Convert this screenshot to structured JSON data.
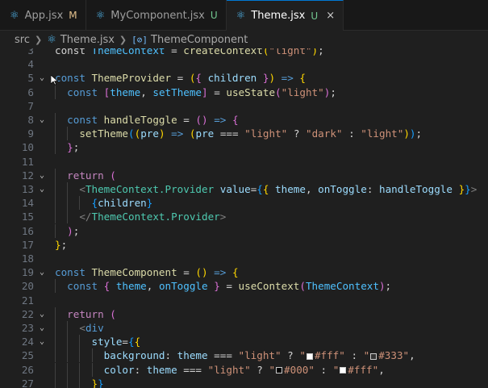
{
  "tabs": [
    {
      "label": "App.jsx",
      "status": "M",
      "active": false
    },
    {
      "label": "MyComponent.jsx",
      "status": "U",
      "active": false
    },
    {
      "label": "Theme.jsx",
      "status": "U",
      "active": true,
      "close": "×"
    }
  ],
  "breadcrumb": {
    "folder": "src",
    "file": "Theme.jsx",
    "symbol": "ThemeComponent"
  },
  "swatch_colors": {
    "fff": "#ffffff",
    "333": "#333333",
    "000": "#000000"
  },
  "lines": [
    {
      "n": "3",
      "fold": false,
      "code": [
        [
          "p",
          "const "
        ],
        [
          "c",
          "ThemeContext"
        ],
        [
          "p",
          " = "
        ],
        [
          "f",
          "createContext"
        ],
        [
          "b1",
          "("
        ],
        [
          "s",
          "\"light\""
        ],
        [
          "b1",
          ")"
        ],
        [
          "p",
          ";"
        ]
      ]
    },
    {
      "n": "4",
      "fold": false,
      "code": []
    },
    {
      "n": "5",
      "fold": true,
      "code": [
        [
          "k",
          "const "
        ],
        [
          "f",
          "ThemeProvider"
        ],
        [
          "p",
          " = "
        ],
        [
          "b1",
          "("
        ],
        [
          "b2",
          "{ "
        ],
        [
          "v",
          "children"
        ],
        [
          "b2",
          " }"
        ],
        [
          "b1",
          ")"
        ],
        [
          "p",
          " "
        ],
        [
          "k",
          "=>"
        ],
        [
          "p",
          " "
        ],
        [
          "b1",
          "{"
        ]
      ]
    },
    {
      "n": "6",
      "fold": false,
      "code": [
        [
          "p",
          "  "
        ],
        [
          "k",
          "const "
        ],
        [
          "b2",
          "["
        ],
        [
          "c",
          "theme"
        ],
        [
          "p",
          ", "
        ],
        [
          "c",
          "setTheme"
        ],
        [
          "b2",
          "]"
        ],
        [
          "p",
          " = "
        ],
        [
          "f",
          "useState"
        ],
        [
          "b2",
          "("
        ],
        [
          "s",
          "\"light\""
        ],
        [
          "b2",
          ")"
        ],
        [
          "p",
          ";"
        ]
      ]
    },
    {
      "n": "7",
      "fold": false,
      "code": []
    },
    {
      "n": "8",
      "fold": true,
      "code": [
        [
          "p",
          "  "
        ],
        [
          "k",
          "const "
        ],
        [
          "f",
          "handleToggle"
        ],
        [
          "p",
          " = "
        ],
        [
          "b2",
          "()"
        ],
        [
          "p",
          " "
        ],
        [
          "k",
          "=>"
        ],
        [
          "p",
          " "
        ],
        [
          "b2",
          "{"
        ]
      ]
    },
    {
      "n": "9",
      "fold": false,
      "code": [
        [
          "p",
          "    "
        ],
        [
          "f",
          "setTheme"
        ],
        [
          "b3",
          "("
        ],
        [
          "b1",
          "("
        ],
        [
          "v",
          "pre"
        ],
        [
          "b1",
          ")"
        ],
        [
          "p",
          " "
        ],
        [
          "k",
          "=>"
        ],
        [
          "p",
          " "
        ],
        [
          "b1",
          "("
        ],
        [
          "v",
          "pre"
        ],
        [
          "p",
          " === "
        ],
        [
          "s",
          "\"light\""
        ],
        [
          "p",
          " ? "
        ],
        [
          "s",
          "\"dark\""
        ],
        [
          "p",
          " : "
        ],
        [
          "s",
          "\"light\""
        ],
        [
          "b1",
          ")"
        ],
        [
          "b3",
          ")"
        ],
        [
          "p",
          ";"
        ]
      ]
    },
    {
      "n": "10",
      "fold": false,
      "code": [
        [
          "p",
          "  "
        ],
        [
          "b2",
          "}"
        ],
        [
          "p",
          ";"
        ]
      ]
    },
    {
      "n": "11",
      "fold": false,
      "code": []
    },
    {
      "n": "12",
      "fold": true,
      "code": [
        [
          "p",
          "  "
        ],
        [
          "kc",
          "return"
        ],
        [
          "p",
          " "
        ],
        [
          "b2",
          "("
        ]
      ]
    },
    {
      "n": "13",
      "fold": true,
      "code": [
        [
          "p",
          "    "
        ],
        [
          "tg",
          "<"
        ],
        [
          "tc",
          "ThemeContext.Provider"
        ],
        [
          "p",
          " "
        ],
        [
          "v",
          "value"
        ],
        [
          "p",
          "="
        ],
        [
          "b3",
          "{"
        ],
        [
          "b1",
          "{ "
        ],
        [
          "v",
          "theme"
        ],
        [
          "p",
          ", "
        ],
        [
          "v",
          "onToggle"
        ],
        [
          "p",
          ": "
        ],
        [
          "v",
          "handleToggle"
        ],
        [
          "b1",
          " }"
        ],
        [
          "b3",
          "}"
        ],
        [
          "tg",
          ">"
        ]
      ]
    },
    {
      "n": "14",
      "fold": false,
      "code": [
        [
          "p",
          "      "
        ],
        [
          "b3",
          "{"
        ],
        [
          "v",
          "children"
        ],
        [
          "b3",
          "}"
        ]
      ]
    },
    {
      "n": "15",
      "fold": false,
      "code": [
        [
          "p",
          "    "
        ],
        [
          "tg",
          "</"
        ],
        [
          "tc",
          "ThemeContext.Provider"
        ],
        [
          "tg",
          ">"
        ]
      ]
    },
    {
      "n": "16",
      "fold": false,
      "code": [
        [
          "p",
          "  "
        ],
        [
          "b2",
          ")"
        ],
        [
          "p",
          ";"
        ]
      ]
    },
    {
      "n": "17",
      "fold": false,
      "code": [
        [
          "b1",
          "}"
        ],
        [
          "p",
          ";"
        ]
      ]
    },
    {
      "n": "18",
      "fold": false,
      "code": []
    },
    {
      "n": "19",
      "fold": true,
      "code": [
        [
          "k",
          "const "
        ],
        [
          "f",
          "ThemeComponent"
        ],
        [
          "p",
          " = "
        ],
        [
          "b1",
          "()"
        ],
        [
          "p",
          " "
        ],
        [
          "k",
          "=>"
        ],
        [
          "p",
          " "
        ],
        [
          "b1",
          "{"
        ]
      ]
    },
    {
      "n": "20",
      "fold": false,
      "code": [
        [
          "p",
          "  "
        ],
        [
          "k",
          "const "
        ],
        [
          "b2",
          "{ "
        ],
        [
          "c",
          "theme"
        ],
        [
          "p",
          ", "
        ],
        [
          "c",
          "onToggle"
        ],
        [
          "b2",
          " }"
        ],
        [
          "p",
          " = "
        ],
        [
          "f",
          "useContext"
        ],
        [
          "b2",
          "("
        ],
        [
          "c",
          "ThemeContext"
        ],
        [
          "b2",
          ")"
        ],
        [
          "p",
          ";"
        ]
      ]
    },
    {
      "n": "21",
      "fold": false,
      "code": []
    },
    {
      "n": "22",
      "fold": true,
      "code": [
        [
          "p",
          "  "
        ],
        [
          "kc",
          "return"
        ],
        [
          "p",
          " "
        ],
        [
          "b2",
          "("
        ]
      ]
    },
    {
      "n": "23",
      "fold": true,
      "code": [
        [
          "p",
          "    "
        ],
        [
          "tg",
          "<"
        ],
        [
          "t",
          "div"
        ]
      ]
    },
    {
      "n": "24",
      "fold": true,
      "code": [
        [
          "p",
          "      "
        ],
        [
          "v",
          "style"
        ],
        [
          "p",
          "="
        ],
        [
          "b3",
          "{"
        ],
        [
          "b1",
          "{"
        ]
      ]
    },
    {
      "n": "25",
      "fold": false,
      "code": [
        [
          "p",
          "        "
        ],
        [
          "v",
          "background"
        ],
        [
          "p",
          ": "
        ],
        [
          "v",
          "theme"
        ],
        [
          "p",
          " === "
        ],
        [
          "s",
          "\"light\""
        ],
        [
          "p",
          " ? "
        ],
        [
          "s",
          "\""
        ],
        [
          "sw:fff",
          ""
        ],
        [
          "s",
          "#fff\""
        ],
        [
          "p",
          " : "
        ],
        [
          "s",
          "\""
        ],
        [
          "sw:333",
          ""
        ],
        [
          "s",
          "#333\""
        ],
        [
          "p",
          ","
        ]
      ]
    },
    {
      "n": "26",
      "fold": false,
      "code": [
        [
          "p",
          "        "
        ],
        [
          "v",
          "color"
        ],
        [
          "p",
          ": "
        ],
        [
          "v",
          "theme"
        ],
        [
          "p",
          " === "
        ],
        [
          "s",
          "\"light\""
        ],
        [
          "p",
          " ? "
        ],
        [
          "s",
          "\""
        ],
        [
          "sw:000",
          ""
        ],
        [
          "s",
          "#000\""
        ],
        [
          "p",
          " : "
        ],
        [
          "s",
          "\""
        ],
        [
          "sw:fff",
          ""
        ],
        [
          "s",
          "#fff\""
        ],
        [
          "p",
          ","
        ]
      ]
    },
    {
      "n": "27",
      "fold": false,
      "code": [
        [
          "p",
          "      "
        ],
        [
          "b1",
          "}"
        ],
        [
          "b3",
          "}"
        ]
      ]
    }
  ]
}
